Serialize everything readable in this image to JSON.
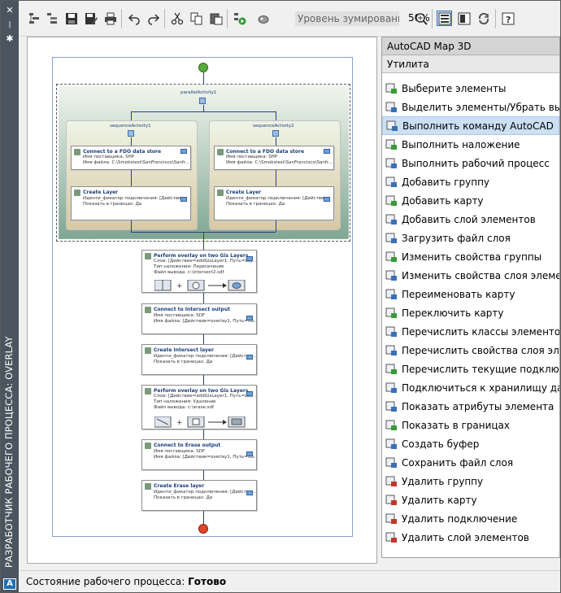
{
  "window": {
    "vertical_title": "РАЗРАБОТЧИК РАБОЧЕГО ПРОЦЕССА: OVERLAY"
  },
  "toolbar": {
    "zoom_label": "Уровень зумирования",
    "zoom_value": "50%"
  },
  "panel": {
    "header": "AutoCAD Map 3D",
    "category": "Утилита",
    "items": [
      "Выберите элементы",
      "Выделить элементы/Убрать выделение",
      "Выполнить команду AutoCAD",
      "Выполнить наложение",
      "Выполнить рабочий процесс",
      "Добавить группу",
      "Добавить карту",
      "Добавить слой элементов",
      "Загрузить файл слоя",
      "Изменить свойства группы",
      "Изменить свойства слоя элементов",
      "Переименовать карту",
      "Переключить карту",
      "Перечислить классы элементов",
      "Перечислить свойства слоя элементов",
      "Перечислить текущие подключения",
      "Подключиться к хранилищу данных",
      "Показать атрибуты элемента",
      "Показать в границах",
      "Создать буфер",
      "Сохранить файл слоя",
      "Удалить группу",
      "Удалить карту",
      "Удалить подключение",
      "Удалить слой элементов"
    ],
    "selected_index": 2
  },
  "status": {
    "label": "Состояние рабочего процесса:",
    "value": "Готово"
  },
  "workflow": {
    "parallel": "parallelActivity1",
    "seq1": "sequenceActivity1",
    "seq2": "sequenceActivity2",
    "connect1": {
      "title": "Connect to a FDO data store",
      "l1": "Имя поставщика: SHP",
      "l2": "Имя файла: C:\\Smokstest\\SanFrancisco\\Sanfr..."
    },
    "connect2": {
      "title": "Connect to a FDO data store",
      "l1": "Имя поставщика: SHP",
      "l2": "Имя файла: C:\\Smokstest\\SanFrancisco\\Sanfr..."
    },
    "layer1": {
      "title": "Create Layer",
      "l1": "Иденти_фикатор подключения: [Действи...",
      "l2": "Показать в границах: Да"
    },
    "layer2": {
      "title": "Create Layer",
      "l1": "Иденти_фикатор подключения: [Действи...",
      "l2": "Показать в границах: Да"
    },
    "overlay1": {
      "title": "Perform overlay on two Gis Layers",
      "l1": "Слои: [Действие=addGisLayer1, Путь=Lay...",
      "l2": "Тип наложения: Пересечение",
      "l3": "Файл вывода: c:\\intersect2.sdf"
    },
    "conn_int": {
      "title": "Connect to Intersect output",
      "l1": "Имя поставщика: SDF",
      "l2": "Имя файла: [Действие=overlay1, Путь=Ou..."
    },
    "layer_int": {
      "title": "Create Intersect layer",
      "l1": "Иденти_фикатор подключения: [Действи...",
      "l2": "Показать в границах: Да"
    },
    "overlay2": {
      "title": "Perform overlay on two Gis Layers",
      "l1": "Слои: [Действие=addGisLayer1, Путь=Lay...",
      "l2": "Тип наложения: Удаление",
      "l3": "Файл вывода: c:\\erase.sdf"
    },
    "conn_erase": {
      "title": "Connect to Erase output",
      "l1": "Имя поставщика: SDF",
      "l2": "Имя файла: [Действие=overlay1, Путь=Ou..."
    },
    "layer_erase": {
      "title": "Create Erase layer",
      "l1": "Иденти_фикатор подключения: [Действи...",
      "l2": "Показать в границах: Да"
    }
  },
  "colors": {
    "sidebar": "#4b5560",
    "selection": "#cce0f4",
    "connector": "#2d3d8c"
  }
}
